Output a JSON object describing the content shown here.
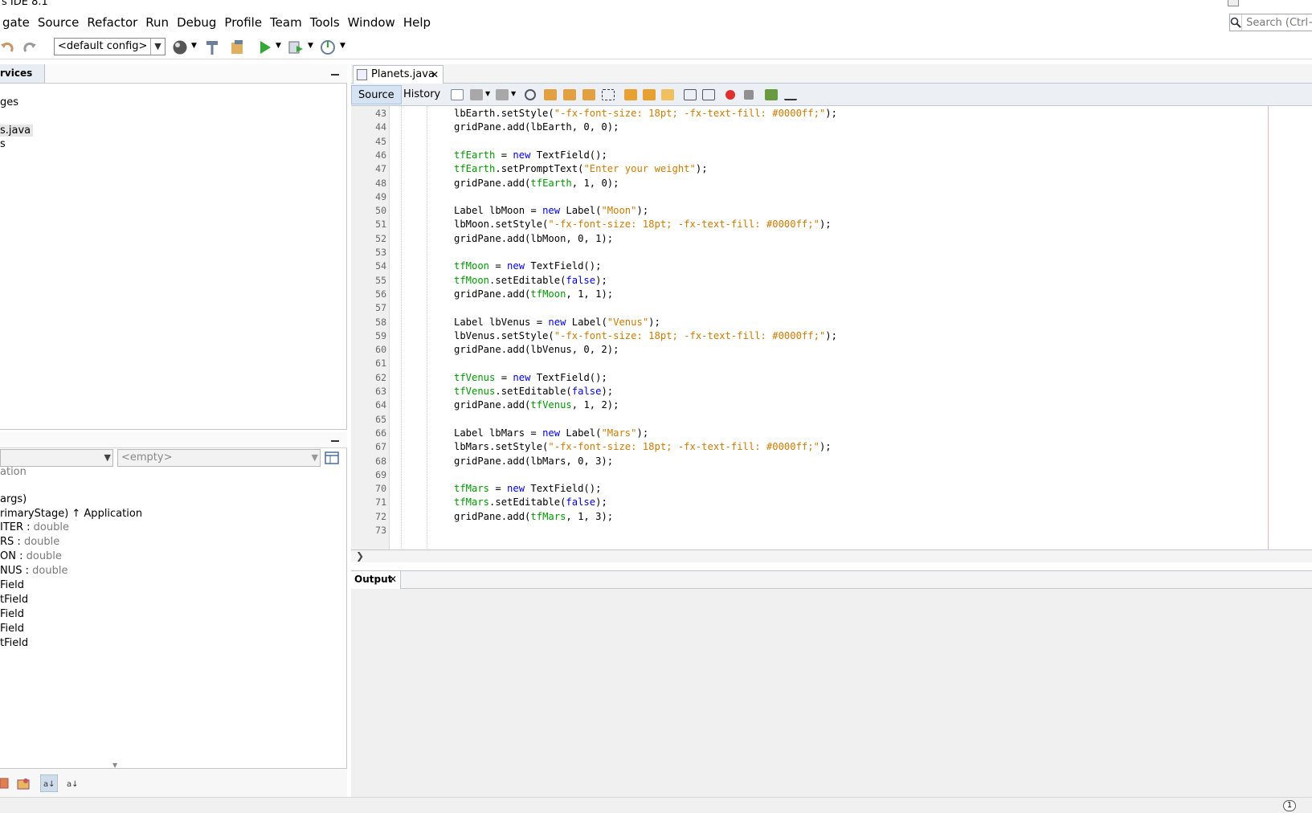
{
  "window": {
    "title": "s IDE 8.1"
  },
  "menu": [
    "gate",
    "Source",
    "Refactor",
    "Run",
    "Debug",
    "Profile",
    "Team",
    "Tools",
    "Window",
    "Help"
  ],
  "search": {
    "placeholder": "Search (Ctrl+"
  },
  "toolbar": {
    "config_value": "<default config>"
  },
  "left_top": {
    "tab_label": "rvices",
    "tree": [
      "ges",
      "s.java",
      "s"
    ]
  },
  "navigator": {
    "filter_right_value": "<empty>",
    "items": [
      {
        "name": "ation",
        "type": ""
      },
      {
        "name": "args)",
        "type": ""
      },
      {
        "name": "rimaryStage) ↑ Application",
        "type": ""
      },
      {
        "name": "ITER : ",
        "type": "double"
      },
      {
        "name": "RS : ",
        "type": "double"
      },
      {
        "name": "ON : ",
        "type": "double"
      },
      {
        "name": "NUS : ",
        "type": "double"
      },
      {
        "name": "",
        "type": "Field"
      },
      {
        "name": "",
        "type": "tField"
      },
      {
        "name": "",
        "type": "Field"
      },
      {
        "name": "",
        "type": "Field"
      },
      {
        "name": "",
        "type": "tField"
      }
    ]
  },
  "editor": {
    "file_tab": "Planets.java",
    "source_label": "Source",
    "history_label": "History",
    "lines": [
      {
        "n": "43",
        "parts": [
          [
            "",
            "lbEarth.setStyle("
          ],
          [
            "str",
            "\"-fx-font-size: 18pt; -fx-text-fill: #0000ff;\""
          ],
          [
            "",
            ");"
          ]
        ]
      },
      {
        "n": "44",
        "parts": [
          [
            "",
            "gridPane.add(lbEarth, 0, 0);"
          ]
        ]
      },
      {
        "n": "45",
        "parts": []
      },
      {
        "n": "46",
        "parts": [
          [
            "fld",
            "tfEarth"
          ],
          [
            "",
            " = "
          ],
          [
            "kw",
            "new"
          ],
          [
            "",
            " TextField();"
          ]
        ]
      },
      {
        "n": "47",
        "parts": [
          [
            "fld",
            "tfEarth"
          ],
          [
            "",
            ".setPromptText("
          ],
          [
            "str",
            "\"Enter your weight\""
          ],
          [
            "",
            ");"
          ]
        ]
      },
      {
        "n": "48",
        "parts": [
          [
            "",
            "gridPane.add("
          ],
          [
            "fld",
            "tfEarth"
          ],
          [
            "",
            ", 1, 0);"
          ]
        ]
      },
      {
        "n": "49",
        "parts": []
      },
      {
        "n": "50",
        "parts": [
          [
            "",
            "Label lbMoon = "
          ],
          [
            "kw",
            "new"
          ],
          [
            "",
            " Label("
          ],
          [
            "str",
            "\"Moon\""
          ],
          [
            "",
            ");"
          ]
        ]
      },
      {
        "n": "51",
        "parts": [
          [
            "",
            "lbMoon.setStyle("
          ],
          [
            "str",
            "\"-fx-font-size: 18pt; -fx-text-fill: #0000ff;\""
          ],
          [
            "",
            ");"
          ]
        ]
      },
      {
        "n": "52",
        "parts": [
          [
            "",
            "gridPane.add(lbMoon, 0, 1);"
          ]
        ]
      },
      {
        "n": "53",
        "parts": []
      },
      {
        "n": "54",
        "parts": [
          [
            "fld",
            "tfMoon"
          ],
          [
            "",
            " = "
          ],
          [
            "kw",
            "new"
          ],
          [
            "",
            " TextField();"
          ]
        ]
      },
      {
        "n": "55",
        "parts": [
          [
            "fld",
            "tfMoon"
          ],
          [
            "",
            ".setEditable("
          ],
          [
            "kw",
            "false"
          ],
          [
            "",
            ");"
          ]
        ]
      },
      {
        "n": "56",
        "parts": [
          [
            "",
            "gridPane.add("
          ],
          [
            "fld",
            "tfMoon"
          ],
          [
            "",
            ", 1, 1);"
          ]
        ]
      },
      {
        "n": "57",
        "parts": []
      },
      {
        "n": "58",
        "parts": [
          [
            "",
            "Label lbVenus = "
          ],
          [
            "kw",
            "new"
          ],
          [
            "",
            " Label("
          ],
          [
            "str",
            "\"Venus\""
          ],
          [
            "",
            ");"
          ]
        ]
      },
      {
        "n": "59",
        "parts": [
          [
            "",
            "lbVenus.setStyle("
          ],
          [
            "str",
            "\"-fx-font-size: 18pt; -fx-text-fill: #0000ff;\""
          ],
          [
            "",
            ");"
          ]
        ]
      },
      {
        "n": "60",
        "parts": [
          [
            "",
            "gridPane.add(lbVenus, 0, 2);"
          ]
        ]
      },
      {
        "n": "61",
        "parts": []
      },
      {
        "n": "62",
        "parts": [
          [
            "fld",
            "tfVenus"
          ],
          [
            "",
            " = "
          ],
          [
            "kw",
            "new"
          ],
          [
            "",
            " TextField();"
          ]
        ]
      },
      {
        "n": "63",
        "parts": [
          [
            "fld",
            "tfVenus"
          ],
          [
            "",
            ".setEditable("
          ],
          [
            "kw",
            "false"
          ],
          [
            "",
            ");"
          ]
        ]
      },
      {
        "n": "64",
        "parts": [
          [
            "",
            "gridPane.add("
          ],
          [
            "fld",
            "tfVenus"
          ],
          [
            "",
            ", 1, 2);"
          ]
        ]
      },
      {
        "n": "65",
        "parts": []
      },
      {
        "n": "66",
        "parts": [
          [
            "",
            "Label lbMars = "
          ],
          [
            "kw",
            "new"
          ],
          [
            "",
            " Label("
          ],
          [
            "str",
            "\"Mars\""
          ],
          [
            "",
            ");"
          ]
        ]
      },
      {
        "n": "67",
        "parts": [
          [
            "",
            "lbMars.setStyle("
          ],
          [
            "str",
            "\"-fx-font-size: 18pt; -fx-text-fill: #0000ff;\""
          ],
          [
            "",
            ");"
          ]
        ]
      },
      {
        "n": "68",
        "parts": [
          [
            "",
            "gridPane.add(lbMars, 0, 3);"
          ]
        ]
      },
      {
        "n": "69",
        "parts": []
      },
      {
        "n": "70",
        "parts": [
          [
            "fld",
            "tfMars"
          ],
          [
            "",
            " = "
          ],
          [
            "kw",
            "new"
          ],
          [
            "",
            " TextField();"
          ]
        ]
      },
      {
        "n": "71",
        "parts": [
          [
            "fld",
            "tfMars"
          ],
          [
            "",
            ".setEditable("
          ],
          [
            "kw",
            "false"
          ],
          [
            "",
            ");"
          ]
        ]
      },
      {
        "n": "72",
        "parts": [
          [
            "",
            "gridPane.add("
          ],
          [
            "fld",
            "tfMars"
          ],
          [
            "",
            ", 1, 3);"
          ]
        ]
      },
      {
        "n": "73",
        "parts": []
      }
    ]
  },
  "output": {
    "tab_label": "Output"
  },
  "status": {
    "badge": "1"
  },
  "colors": {
    "keyword": "#0000e6",
    "field": "#009900",
    "string": "#ce7b00",
    "margin": "#f2b8b8"
  }
}
